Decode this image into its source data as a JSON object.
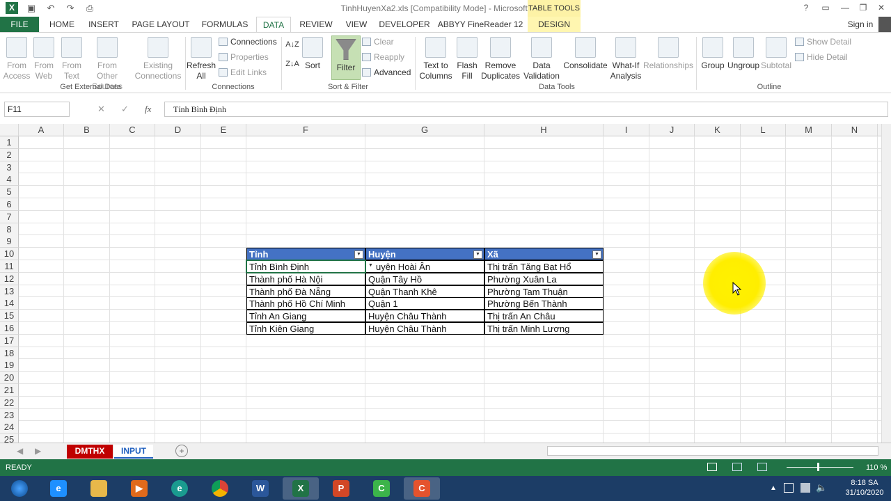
{
  "window": {
    "doc_title": "TinhHuyenXa2.xls  [Compatibility Mode] - Microsoft Excel",
    "sign_in": "Sign in",
    "table_tools": "TABLE TOOLS"
  },
  "tabs": [
    "FILE",
    "HOME",
    "INSERT",
    "PAGE LAYOUT",
    "FORMULAS",
    "DATA",
    "REVIEW",
    "VIEW",
    "DEVELOPER",
    "ABBYY FineReader 12",
    "DESIGN"
  ],
  "ribbon": {
    "get_external": {
      "from_access": "From Access",
      "from_web": "From Web",
      "from_text": "From Text",
      "from_other": "From Other Sources",
      "existing": "Existing Connections",
      "group": "Get External Data"
    },
    "connections": {
      "refresh": "Refresh All",
      "connections": "Connections",
      "properties": "Properties",
      "edit_links": "Edit Links",
      "group": "Connections"
    },
    "sort_filter": {
      "sort": "Sort",
      "filter": "Filter",
      "clear": "Clear",
      "reapply": "Reapply",
      "advanced": "Advanced",
      "group": "Sort & Filter"
    },
    "data_tools": {
      "text_to_columns": "Text to Columns",
      "flash_fill": "Flash Fill",
      "remove_dup": "Remove Duplicates",
      "validation": "Data Validation",
      "consolidate": "Consolidate",
      "what_if": "What-If Analysis",
      "relationships": "Relationships",
      "group": "Data Tools"
    },
    "outline": {
      "group_btn": "Group",
      "ungroup": "Ungroup",
      "subtotal": "Subtotal",
      "show_detail": "Show Detail",
      "hide_detail": "Hide Detail",
      "group": "Outline"
    }
  },
  "formula_bar": {
    "name_box": "F11",
    "fx": "fx",
    "value": "Tỉnh Bình Định"
  },
  "columns": [
    "A",
    "B",
    "C",
    "D",
    "E",
    "F",
    "G",
    "H",
    "I",
    "J",
    "K",
    "L",
    "M",
    "N"
  ],
  "rows": [
    "1",
    "2",
    "3",
    "4",
    "5",
    "6",
    "7",
    "8",
    "9",
    "10",
    "11",
    "12",
    "13",
    "14",
    "15",
    "16",
    "17",
    "18",
    "19",
    "20",
    "21",
    "22",
    "23",
    "24",
    "25"
  ],
  "table": {
    "headers": [
      "Tỉnh",
      "Huyện",
      "Xã"
    ],
    "rows": [
      [
        "Tỉnh Bình Định",
        "uyện Hoài Ân",
        "Thị trấn Tăng Bạt Hổ"
      ],
      [
        "Thành phố Hà Nội",
        "Quận Tây Hồ",
        "Phường Xuân La"
      ],
      [
        "Thành phố Đà Nẵng",
        "Quận Thanh Khê",
        "Phường Tam Thuận"
      ],
      [
        "Thành phố Hồ Chí Minh",
        "Quận 1",
        "Phường Bến Thành"
      ],
      [
        "Tỉnh An Giang",
        "Huyện Châu Thành",
        "Thị trấn An Châu"
      ],
      [
        "Tỉnh Kiên Giang",
        "Huyện Châu Thành",
        "Thị trấn Minh Lương"
      ]
    ]
  },
  "sheets": [
    {
      "name": "DMTHX",
      "color": "#c00000"
    },
    {
      "name": "INPUT",
      "color": "#1f5fbf"
    }
  ],
  "status": {
    "ready": "READY",
    "zoom": "110 %"
  },
  "clock": {
    "time": "8:18 SA",
    "date": "31/10/2020"
  },
  "taskbar_apps": [
    "start-icon",
    "ie-icon",
    "explorer-icon",
    "media-icon",
    "edge-icon",
    "chrome-icon",
    "word-icon",
    "excel-icon",
    "powerpoint-icon",
    "camtasia-icon",
    "camtasia-rec-icon"
  ]
}
